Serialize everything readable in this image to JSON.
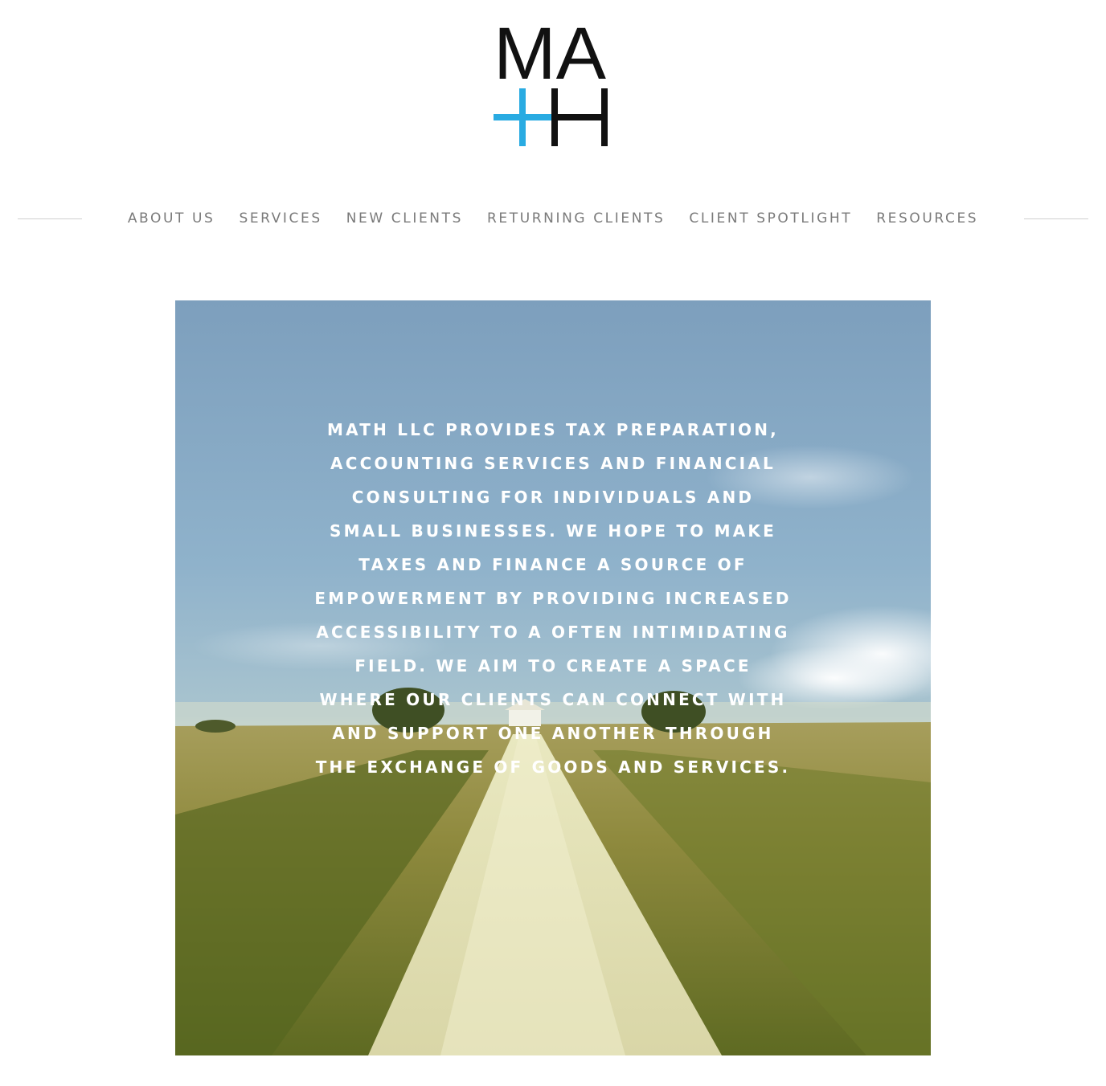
{
  "logo": {
    "letters_top": "MA",
    "letters_bottom": "H",
    "plus_color": "#29abe2",
    "letter_color": "#111111",
    "icon": "math-plus-logo"
  },
  "nav": {
    "items": [
      {
        "label": "ABOUT US"
      },
      {
        "label": "SERVICES"
      },
      {
        "label": "NEW CLIENTS"
      },
      {
        "label": "RETURNING CLIENTS"
      },
      {
        "label": "CLIENT SPOTLIGHT"
      },
      {
        "label": "RESOURCES"
      }
    ],
    "color": "#7a7a7a"
  },
  "hero": {
    "text": "MATH LLC PROVIDES TAX PREPARATION, ACCOUNTING SERVICES AND FINANCIAL CONSULTING FOR INDIVIDUALS AND SMALL BUSINESSES. WE HOPE TO MAKE TAXES AND FINANCE A SOURCE OF EMPOWERMENT BY PROVIDING INCREASED ACCESSIBILITY TO A OFTEN INTIMIDATING FIELD. WE AIM TO CREATE A SPACE WHERE OUR CLIENTS CAN CONNECT WITH AND SUPPORT ONE ANOTHER THROUGH THE EXCHANGE OF GOODS AND SERVICES.",
    "image": "country-gravel-road-photo"
  }
}
